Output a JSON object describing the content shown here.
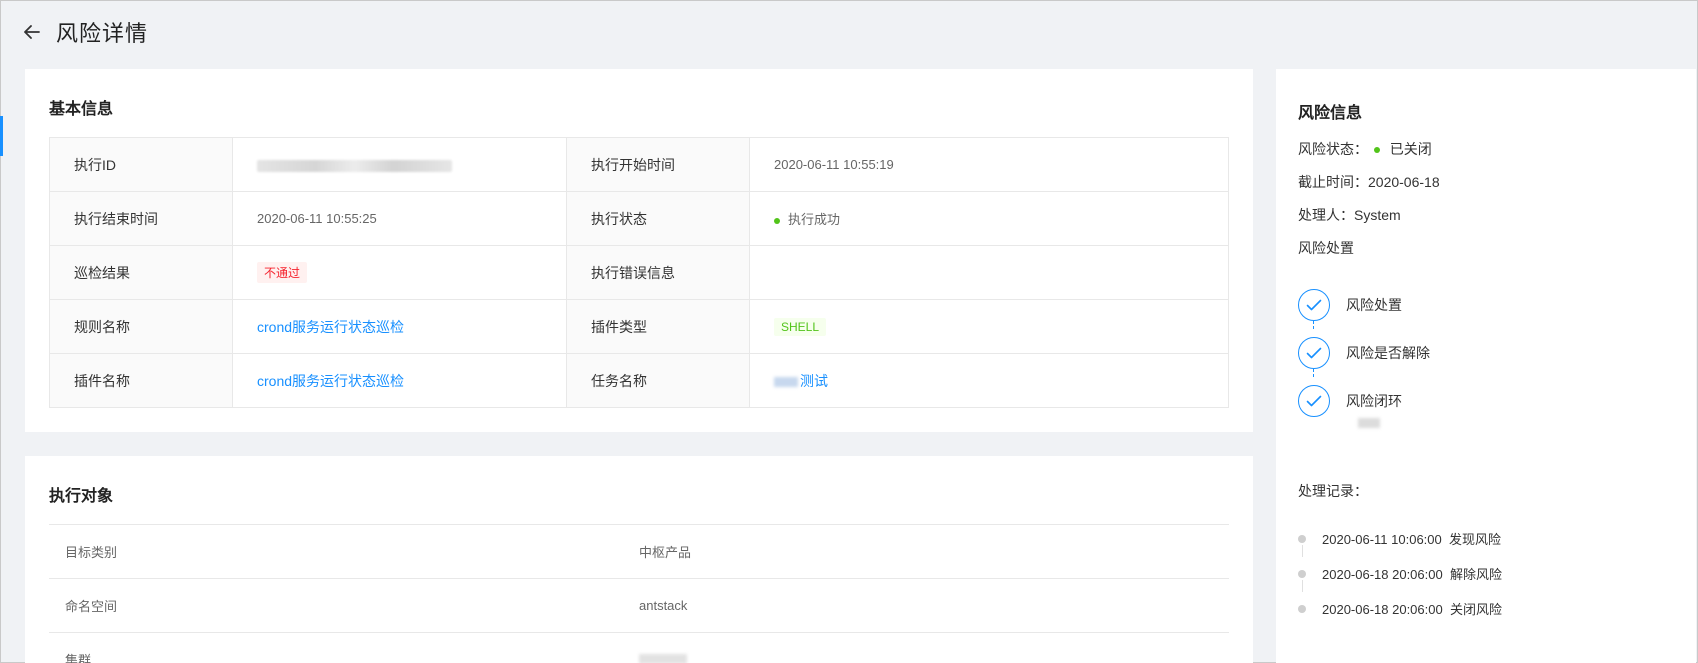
{
  "header": {
    "title": "风险详情",
    "back_icon": "arrow-left-icon"
  },
  "basic": {
    "title": "基本信息",
    "rows": [
      {
        "l1": "执行ID",
        "v1": "",
        "l2": "执行开始时间",
        "v2": "2020-06-11 10:55:19"
      },
      {
        "l1": "执行结束时间",
        "v1": "2020-06-11 10:55:25",
        "l2": "执行状态",
        "v2": "执行成功"
      },
      {
        "l1": "巡检结果",
        "v1": "不通过",
        "l2": "执行错误信息",
        "v2": ""
      },
      {
        "l1": "规则名称",
        "v1": "crond服务运行状态巡检",
        "l2": "插件类型",
        "v2": "SHELL"
      },
      {
        "l1": "插件名称",
        "v1": "crond服务运行状态巡检",
        "l2": "任务名称",
        "v2": "测试"
      }
    ]
  },
  "target": {
    "title": "执行对象",
    "rows": [
      {
        "label": "目标类别",
        "value": "中枢产品"
      },
      {
        "label": "命名空间",
        "value": "antstack"
      },
      {
        "label": "集群",
        "value": ""
      }
    ]
  },
  "risk": {
    "title": "风险信息",
    "status_label": "风险状态：",
    "status_value": "已关闭",
    "deadline_label": "截止时间：",
    "deadline_value": "2020-06-18",
    "handler_label": "处理人：",
    "handler_value": "System",
    "disposal_label": "风险处置",
    "steps": [
      {
        "label": "风险处置"
      },
      {
        "label": "风险是否解除"
      },
      {
        "label": "风险闭环"
      }
    ],
    "log_title": "处理记录：",
    "logs": [
      {
        "time": "2020-06-11 10:06:00",
        "action": "发现风险"
      },
      {
        "time": "2020-06-18 20:06:00",
        "action": "解除风险"
      },
      {
        "time": "2020-06-18 20:06:00",
        "action": "关闭风险"
      }
    ]
  },
  "colors": {
    "accent": "#1890ff",
    "success": "#52c41a",
    "danger": "#f5222d",
    "background": "#f0f2f5"
  }
}
